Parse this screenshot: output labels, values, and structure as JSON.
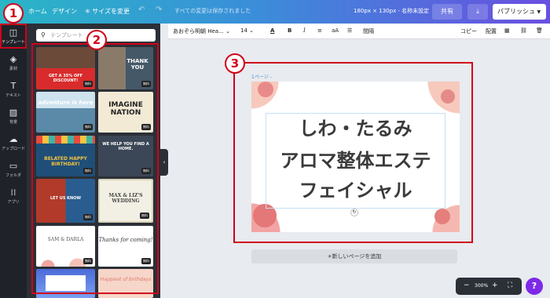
{
  "topbar": {
    "home": "ホーム",
    "design": "デザイン",
    "resize": "サイズを変更",
    "save_status": "すべての変更は保存されました",
    "doc_name": "180px × 130px - 名称未設定",
    "share": "共有",
    "publish": "パブリッシュ"
  },
  "leftnav": [
    {
      "label": "テンプレート",
      "icon": "template-icon"
    },
    {
      "label": "素材",
      "icon": "elements-icon"
    },
    {
      "label": "テキスト",
      "icon": "text-icon"
    },
    {
      "label": "背景",
      "icon": "background-icon"
    },
    {
      "label": "アップロード",
      "icon": "upload-icon"
    },
    {
      "label": "フォルダ",
      "icon": "folder-icon"
    },
    {
      "label": "アプリ",
      "icon": "apps-icon"
    }
  ],
  "search": {
    "placeholder": "テンプレート"
  },
  "templates": [
    {
      "text": "GET A 35% OFF DISCOUNT!",
      "free": "無料"
    },
    {
      "text": "THANK YOU",
      "free": "無料"
    },
    {
      "text": "adventure is here",
      "free": "無料"
    },
    {
      "text": "IMAGINE NATION",
      "free": "無料"
    },
    {
      "text": "BELATED HAPPY BIRTHDAY!",
      "free": "無料"
    },
    {
      "text": "WE HELP YOU FIND A HOME.",
      "free": "無料"
    },
    {
      "text": "LET US KNOW",
      "free": "無料"
    },
    {
      "text": "MAX & LIZ'S WEDDING",
      "free": "無料"
    },
    {
      "text": "SAM & DARLA",
      "free": "無料"
    },
    {
      "text": "Thanks for coming!",
      "free": "無料"
    },
    {
      "text": "",
      "free": ""
    },
    {
      "text": "Happiest of birthdays",
      "free": ""
    }
  ],
  "toolbar": {
    "font": "あおぞら明朝 Hea...",
    "size": "14",
    "copy": "コピー",
    "arrange": "配置",
    "spacing": "間隔"
  },
  "canvas": {
    "page_label": "1ページ -",
    "line1": "しわ・たるみ",
    "line2": "アロマ整体エステ",
    "line3": "フェイシャル"
  },
  "add_page": "+新しいページを追加",
  "zoom": {
    "value": "300%",
    "minus": "−",
    "plus": "+"
  },
  "help": "?",
  "badges": [
    "1",
    "2",
    "3"
  ],
  "colors": {
    "accent": "#d0021b",
    "brand": "#7d2ae8"
  }
}
